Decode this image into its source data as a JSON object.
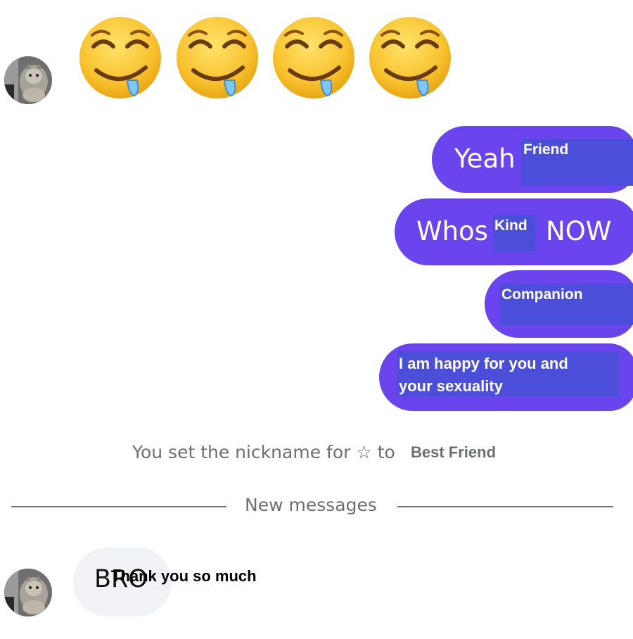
{
  "emojis": [
    "drooling-face-emoji",
    "drooling-face-emoji",
    "drooling-face-emoji",
    "drooling-face-emoji"
  ],
  "messages_out": [
    {
      "text": "Yeah",
      "overlay": "Friend"
    },
    {
      "text_before": "Whos",
      "text_after": "NOW",
      "overlay": "Kind"
    },
    {
      "overlay": "Companion"
    },
    {
      "overlay_line1": "I am happy for you and",
      "overlay_line2": "your sexuality"
    }
  ],
  "system_message": {
    "text": "You set the nickname for ☆ to",
    "nickname": "Best Friend"
  },
  "divider": {
    "label": "New messages"
  },
  "message_in": {
    "text": "BRO",
    "overlay": "Thank you so much"
  },
  "colors": {
    "bubble_out": "#6a45ee",
    "overlay_box": "#4a4ed8",
    "bubble_in": "#f0f2f5",
    "muted_text": "#6b6f75"
  }
}
